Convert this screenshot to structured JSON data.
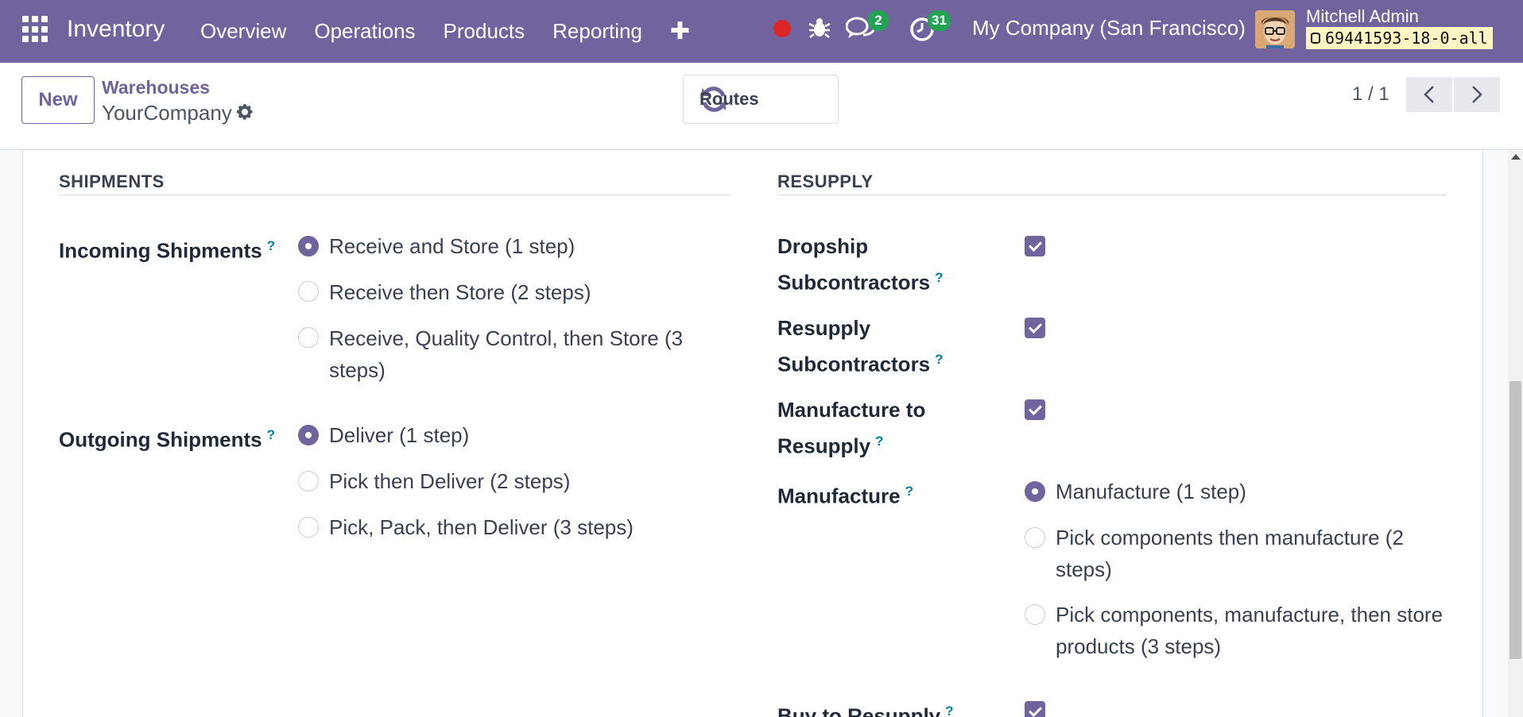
{
  "navbar": {
    "app_name": "Inventory",
    "menu": [
      "Overview",
      "Operations",
      "Products",
      "Reporting"
    ],
    "plus": "✚",
    "messages_count": "2",
    "activities_count": "31",
    "company": "My Company (San Francisco)",
    "user_name": "Mitchell Admin",
    "database": "69441593-18-0-all",
    "accent_color": "#71639e"
  },
  "control_panel": {
    "new_label": "New",
    "breadcrumb": "Warehouses",
    "record_name": "YourCompany",
    "routes_label": "Routes",
    "pager": "1 / 1"
  },
  "shipments": {
    "title": "SHIPMENTS",
    "incoming": {
      "label": "Incoming Shipments",
      "options": [
        "Receive and Store (1 step)",
        "Receive then Store (2 steps)",
        "Receive, Quality Control, then Store (3",
        "steps)"
      ],
      "selected": "Receive and Store (1 step)"
    },
    "outgoing": {
      "label": "Outgoing Shipments",
      "options": [
        "Deliver (1 step)",
        "Pick then Deliver (2 steps)",
        "Pick, Pack, then Deliver (3 steps)"
      ],
      "selected": "Deliver (1 step)"
    }
  },
  "resupply": {
    "title": "RESUPPLY",
    "dropship": {
      "label_1": "Dropship",
      "label_2": "Subcontractors",
      "checked": true
    },
    "resupply_sub": {
      "label_1": "Resupply",
      "label_2": "Subcontractors",
      "checked": true
    },
    "manufacture_to": {
      "label_1": "Manufacture to",
      "label_2": "Resupply",
      "checked": true
    },
    "manufacture": {
      "label": "Manufacture",
      "options": [
        "Manufacture (1 step)",
        "Pick components then manufacture (2",
        "steps)",
        "Pick components, manufacture, then store",
        "products (3 steps)"
      ],
      "selected": "Manufacture (1 step)"
    },
    "buy": {
      "label": "Buy to Resupply",
      "checked": true
    }
  },
  "help_mark": "?"
}
